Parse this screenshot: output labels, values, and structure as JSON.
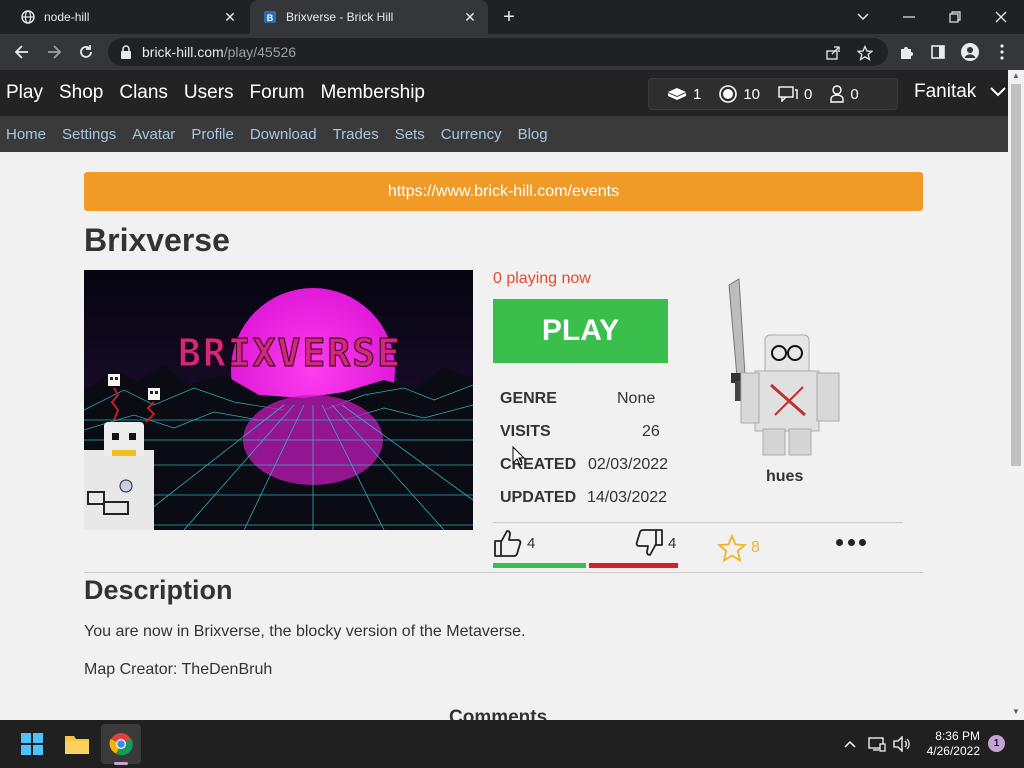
{
  "browser": {
    "tabs": [
      {
        "title": "node-hill",
        "favicon": "globe-icon",
        "active": false
      },
      {
        "title": "Brixverse - Brick Hill",
        "favicon": "brick-hill-icon",
        "active": true
      }
    ],
    "url_host": "brick-hill.com",
    "url_path": "/play/45526"
  },
  "site": {
    "main_nav": [
      "Play",
      "Shop",
      "Clans",
      "Users",
      "Forum",
      "Membership"
    ],
    "counters": {
      "bricks": "1",
      "bucks": "10",
      "messages": "0",
      "friends": "0"
    },
    "username": "Fanitak",
    "sub_nav": [
      "Home",
      "Settings",
      "Avatar",
      "Profile",
      "Download",
      "Trades",
      "Sets",
      "Currency",
      "Blog"
    ]
  },
  "game": {
    "banner": "https://www.brick-hill.com/events",
    "title": "Brixverse",
    "thumbnail_text": "BRIXVERSE",
    "playing": "0 playing now",
    "play_label": "PLAY",
    "stats": {
      "genre_label": "GENRE",
      "genre": "None",
      "visits_label": "VISITS",
      "visits": "26",
      "created_label": "CREATED",
      "created": "02/03/2022",
      "updated_label": "UPDATED",
      "updated": "14/03/2022"
    },
    "creator": "hues",
    "likes": "4",
    "dislikes": "4",
    "favorites": "8",
    "like_ratio": 0.5,
    "description_heading": "Description",
    "description_lines": [
      "You are now in Brixverse, the blocky version of the Metaverse.",
      "Map Creator: TheDenBruh"
    ],
    "comments_heading": "Comments"
  },
  "taskbar": {
    "time": "8:36 PM",
    "date": "4/26/2022",
    "notifications": "1"
  },
  "colors": {
    "banner": "#f09a27",
    "play": "#3bbf4c",
    "playing_text": "#e24c33",
    "favorite": "#f0b429",
    "dislike_bar": "#d61f2b"
  }
}
